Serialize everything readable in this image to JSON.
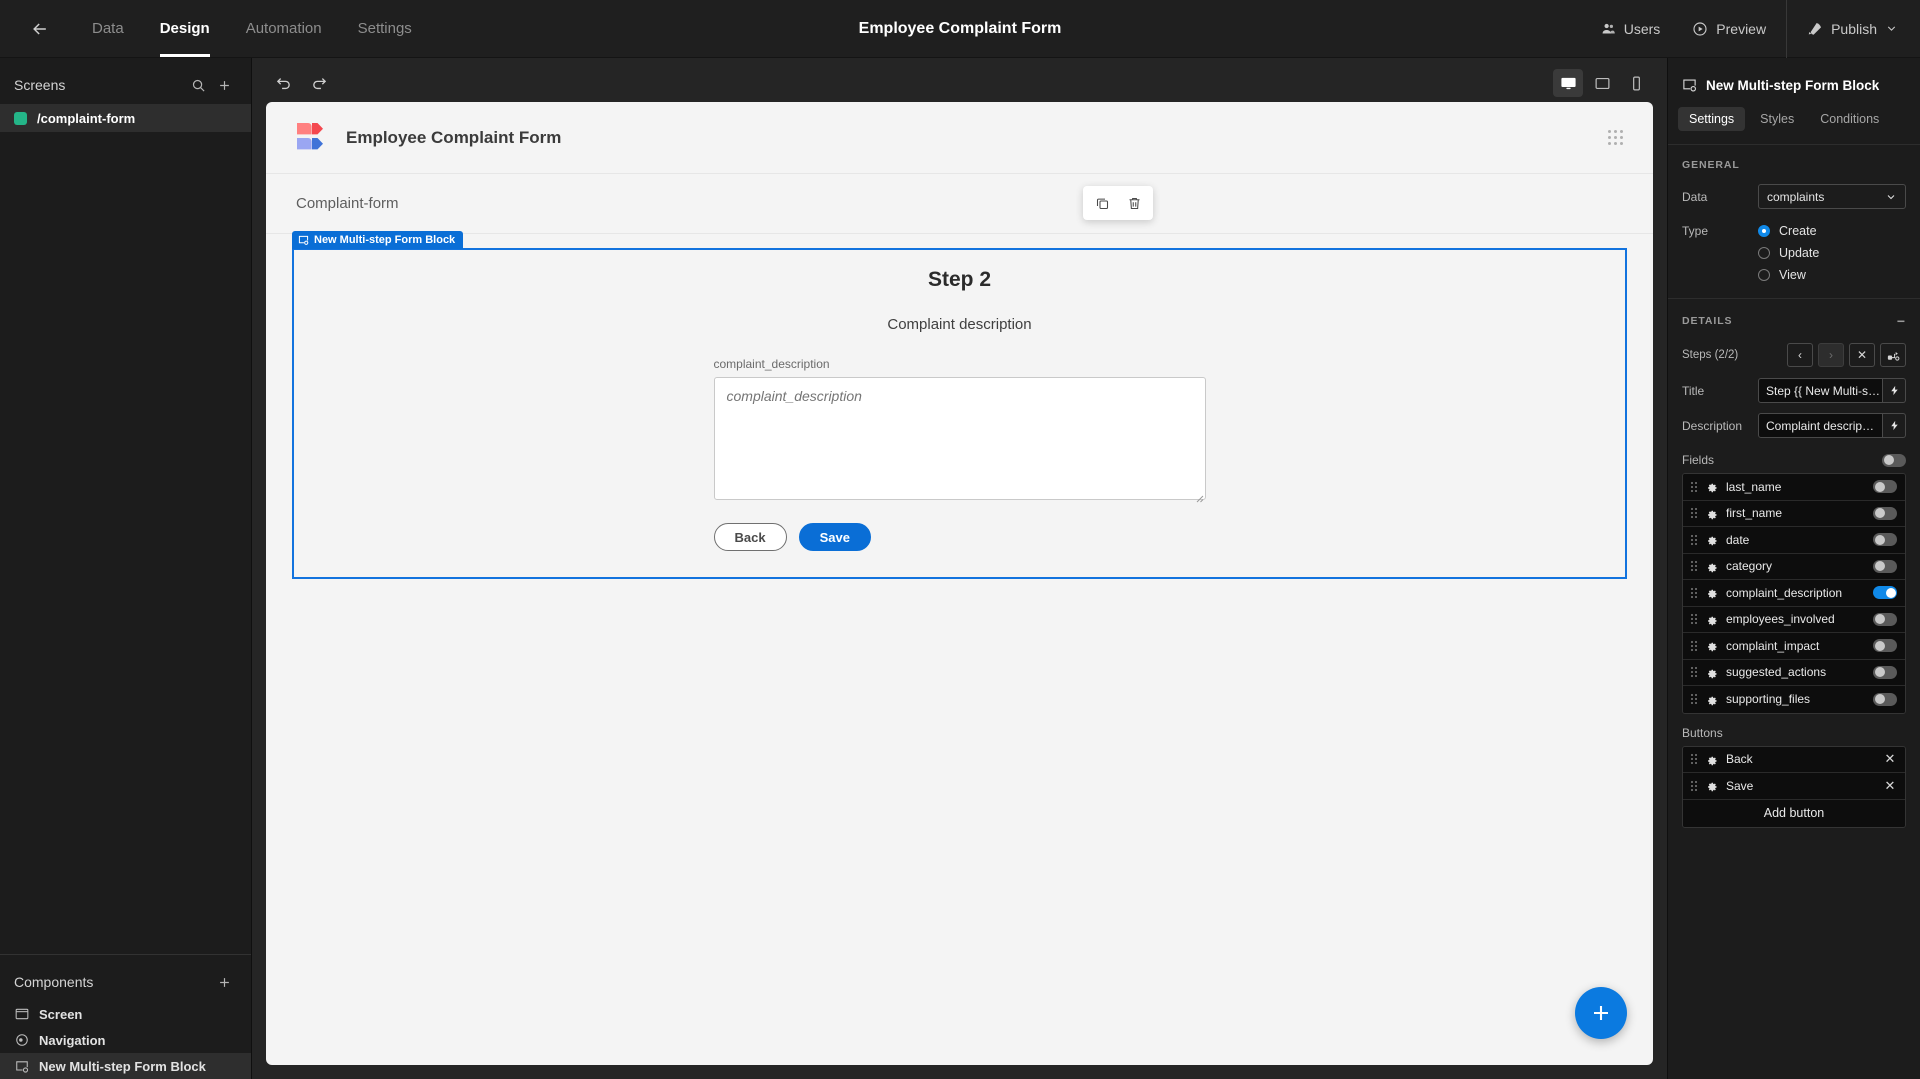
{
  "topbar": {
    "back_icon": "arrow-left-icon",
    "tabs": [
      {
        "label": "Data",
        "active": false
      },
      {
        "label": "Design",
        "active": true
      },
      {
        "label": "Automation",
        "active": false
      },
      {
        "label": "Settings",
        "active": false
      }
    ],
    "app_title": "Employee Complaint Form",
    "users_label": "Users",
    "preview_label": "Preview",
    "publish_label": "Publish"
  },
  "left_panel": {
    "screens_title": "Screens",
    "search_icon": "search-icon",
    "add_icon": "plus-icon",
    "screens": [
      {
        "label": "/complaint-form",
        "color": "#24b588",
        "selected": true
      }
    ],
    "components_title": "Components",
    "components_add_icon": "plus-icon",
    "tree": [
      {
        "label": "Screen",
        "icon": "screen-icon",
        "selected": false
      },
      {
        "label": "Navigation",
        "icon": "navigation-icon",
        "selected": false
      },
      {
        "label": "New Multi-step Form Block",
        "icon": "form-block-icon",
        "selected": true
      }
    ]
  },
  "center": {
    "undo_icon": "undo-icon",
    "redo_icon": "redo-icon",
    "devices": [
      {
        "name": "desktop",
        "active": true
      },
      {
        "name": "tablet",
        "active": false
      },
      {
        "name": "mobile",
        "active": false
      }
    ],
    "canvas_title": "Employee Complaint Form",
    "screen_name": "Complaint-form",
    "float_tools": [
      {
        "name": "duplicate-icon"
      },
      {
        "name": "delete-icon"
      }
    ],
    "block_tag": "New Multi-step Form Block",
    "form": {
      "step_title": "Step 2",
      "step_description": "Complaint description",
      "field_label": "complaint_description",
      "field_placeholder": "complaint_description",
      "field_value": "",
      "back_label": "Back",
      "save_label": "Save"
    },
    "fab_icon": "plus-icon"
  },
  "right_panel": {
    "header_title": "New Multi-step Form Block",
    "header_icon": "form-block-icon",
    "tabs": [
      {
        "label": "Settings",
        "active": true
      },
      {
        "label": "Styles",
        "active": false
      },
      {
        "label": "Conditions",
        "active": false
      }
    ],
    "general": {
      "section_title": "GENERAL",
      "data_label": "Data",
      "data_value": "complaints",
      "type_label": "Type",
      "type_options": [
        {
          "label": "Create",
          "selected": true
        },
        {
          "label": "Update",
          "selected": false
        },
        {
          "label": "View",
          "selected": false
        }
      ]
    },
    "details": {
      "section_title": "DETAILS",
      "collapse_icon": "minus-icon",
      "steps_label": "Steps (2/2)",
      "step_buttons": [
        {
          "name": "prev-step-button",
          "glyph": "‹",
          "disabled": false
        },
        {
          "name": "next-step-button",
          "glyph": "›",
          "disabled": true
        },
        {
          "name": "remove-step-button",
          "glyph": "✕",
          "disabled": false
        },
        {
          "name": "step-flow-button",
          "glyph": "flow-icon",
          "disabled": false
        }
      ],
      "title_label": "Title",
      "title_value": "Step {{ New Multi-s…",
      "description_label": "Description",
      "description_value": "Complaint descrip…",
      "binding_icon": "lightning-icon",
      "fields_label": "Fields",
      "fields_master_on": false,
      "fields": [
        {
          "name": "last_name",
          "on": false
        },
        {
          "name": "first_name",
          "on": false
        },
        {
          "name": "date",
          "on": false
        },
        {
          "name": "category",
          "on": false
        },
        {
          "name": "complaint_description",
          "on": true
        },
        {
          "name": "employees_involved",
          "on": false
        },
        {
          "name": "complaint_impact",
          "on": false
        },
        {
          "name": "suggested_actions",
          "on": false
        },
        {
          "name": "supporting_files",
          "on": false
        }
      ],
      "buttons_label": "Buttons",
      "buttons": [
        {
          "label": "Back"
        },
        {
          "label": "Save"
        }
      ],
      "add_button_label": "Add button"
    }
  },
  "colors": {
    "accent": "#1089e8",
    "primary_blue": "#0a6ed6",
    "screen_dot": "#24b588",
    "panel_bg": "#1c1c1c",
    "canvas_bg": "#f4f4f4"
  }
}
